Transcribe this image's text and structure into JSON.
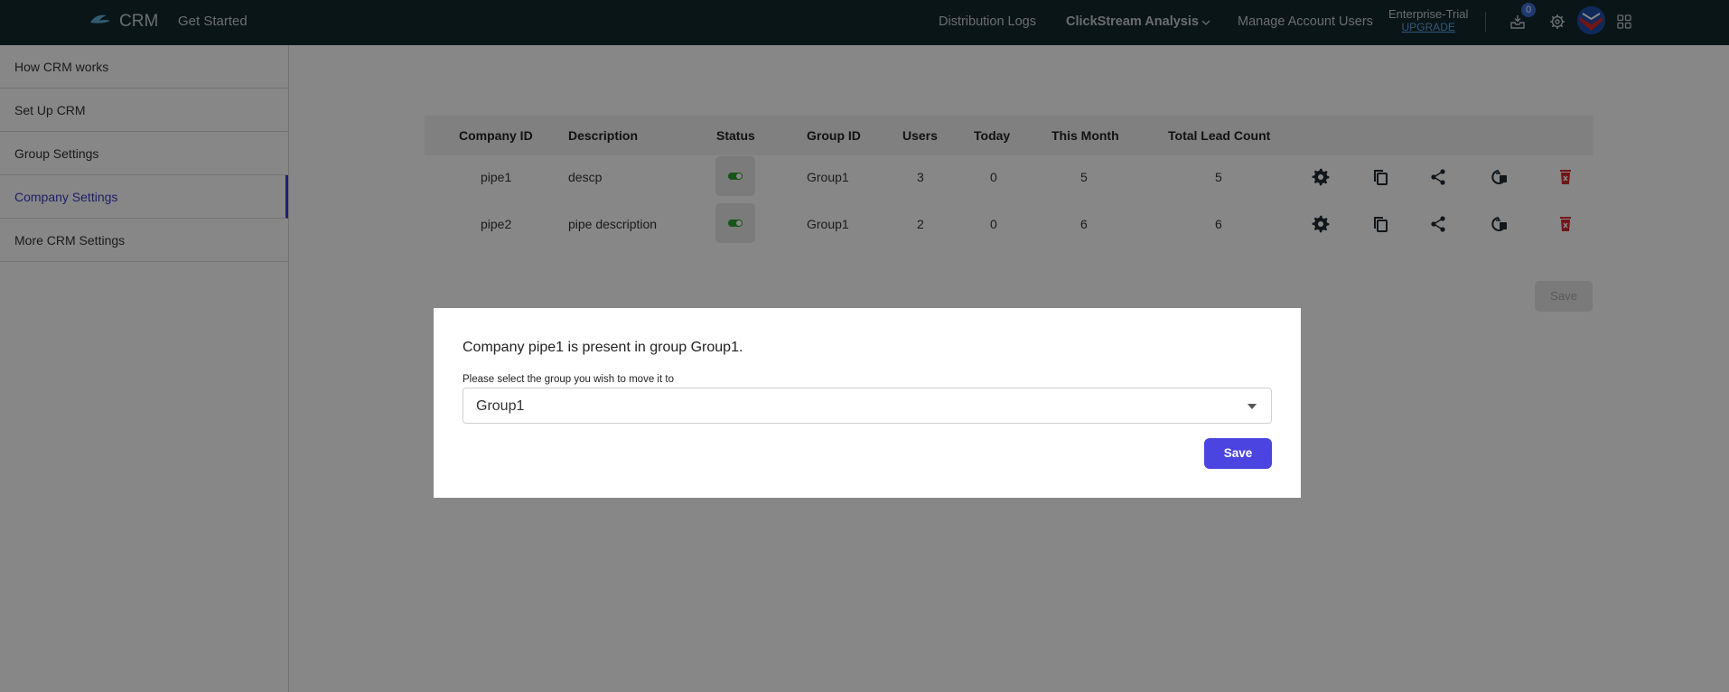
{
  "topbar": {
    "brand": "CRM",
    "get_started": "Get Started",
    "nav": [
      "Distribution Logs",
      "ClickStream Analysis",
      "Manage Account Users"
    ],
    "plan": "Enterprise-Trial",
    "upgrade": "UPGRADE",
    "notifications_count": "0"
  },
  "sidebar": {
    "items": [
      {
        "label": "How CRM works"
      },
      {
        "label": "Set Up CRM"
      },
      {
        "label": "Group Settings"
      },
      {
        "label": "Company Settings"
      },
      {
        "label": "More CRM Settings"
      }
    ],
    "active_index": 3
  },
  "table": {
    "headers": [
      "Company ID",
      "Description",
      "Status",
      "Group ID",
      "Users",
      "Today",
      "This Month",
      "Total Lead Count"
    ],
    "rows": [
      {
        "company_id": "pipe1",
        "description": "descp",
        "status": "on",
        "group_id": "Group1",
        "users": "3",
        "today": "0",
        "this_month": "5",
        "total": "5"
      },
      {
        "company_id": "pipe2",
        "description": "pipe description",
        "status": "on",
        "group_id": "Group1",
        "users": "2",
        "today": "0",
        "this_month": "6",
        "total": "6"
      }
    ],
    "row_actions": [
      "settings-icon",
      "copy-icon",
      "share-icon",
      "move-icon",
      "delete-icon"
    ],
    "save_label": "Save"
  },
  "modal": {
    "message": "Company pipe1 is present in group Group1.",
    "select_label": "Please select the group you wish to move it to",
    "selected_group": "Group1",
    "save_label": "Save"
  },
  "colors": {
    "topbar": "#13282f",
    "accent": "#4b44e0",
    "active_sidebar": "#3c3cc4",
    "status_on": "#2ca02c",
    "delete": "#d6282e"
  }
}
